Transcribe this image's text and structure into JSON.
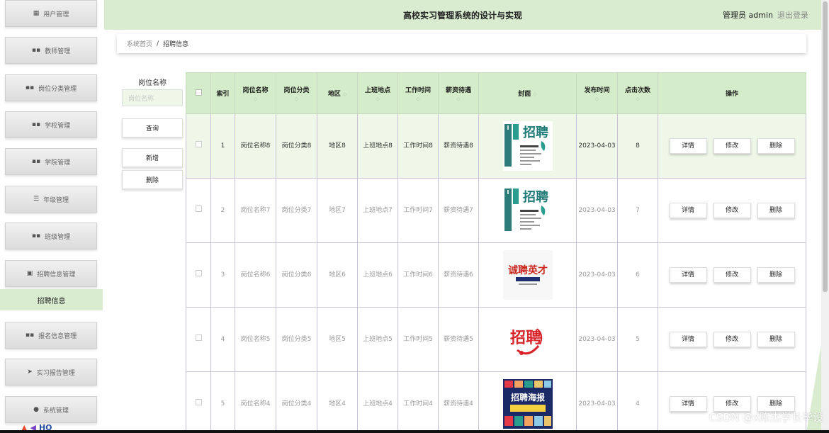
{
  "sidebar": {
    "items": [
      {
        "label": "用户管理",
        "icon": "user-group-icon",
        "glyph": "▦"
      },
      {
        "label": "教师管理",
        "icon": "grid-icon",
        "glyph": "▪▪"
      },
      {
        "label": "岗位分类管理",
        "icon": "grid-icon",
        "glyph": "▪▪"
      },
      {
        "label": "学校管理",
        "icon": "grid-icon",
        "glyph": "▪▪"
      },
      {
        "label": "学院管理",
        "icon": "grid-icon",
        "glyph": "▪▪"
      },
      {
        "label": "年级管理",
        "icon": "list-icon",
        "glyph": "☰"
      },
      {
        "label": "班级管理",
        "icon": "grid-icon",
        "glyph": "▪▪"
      },
      {
        "label": "招聘信息管理",
        "icon": "clipboard-icon",
        "glyph": "▣"
      },
      {
        "label": "报名信息管理",
        "icon": "grid-icon",
        "glyph": "▪▪"
      },
      {
        "label": "实习报告管理",
        "icon": "send-icon",
        "glyph": "➤"
      },
      {
        "label": "系统管理",
        "icon": "pin-icon",
        "glyph": "●"
      }
    ],
    "active_sub": "招聘信息",
    "bottom_logo": "HO"
  },
  "header": {
    "title": "高校实习管理系统的设计与实现",
    "user": "管理员 admin",
    "logout": "退出登录"
  },
  "breadcrumb": {
    "home": "系统首页",
    "sep": "/",
    "current": "招聘信息"
  },
  "search": {
    "label": "岗位名称",
    "placeholder": "岗位名称",
    "query_btn": "查询",
    "add_btn": "新增",
    "delete_btn": "删除"
  },
  "table": {
    "headers": {
      "index": "索引",
      "name": "岗位名称",
      "category": "岗位分类",
      "region": "地区",
      "location": "上班地点",
      "time": "工作时间",
      "salary": "薪资待遇",
      "cover": "封面",
      "date": "发布时间",
      "clicks": "点击次数",
      "ops": "操作"
    },
    "sort_glyph": "◇",
    "actions": {
      "detail": "详情",
      "edit": "修改",
      "delete": "删除"
    },
    "rows": [
      {
        "index": "1",
        "name": "岗位名称8",
        "category": "岗位分类8",
        "region": "地区8",
        "location": "上班地点8",
        "time": "工作时间8",
        "salary": "薪资待遇8",
        "date": "2023-04-03",
        "clicks": "8",
        "cover_text": "招聘"
      },
      {
        "index": "2",
        "name": "岗位名称7",
        "category": "岗位分类7",
        "region": "地区7",
        "location": "上班地点7",
        "time": "工作时间7",
        "salary": "薪资待遇7",
        "date": "2023-04-03",
        "clicks": "7",
        "cover_text": "招聘"
      },
      {
        "index": "3",
        "name": "岗位名称6",
        "category": "岗位分类6",
        "region": "地区6",
        "location": "上班地点6",
        "time": "工作时间6",
        "salary": "薪资待遇6",
        "date": "2023-04-03",
        "clicks": "6",
        "cover_text": "诚聘英才"
      },
      {
        "index": "4",
        "name": "岗位名称5",
        "category": "岗位分类5",
        "region": "地区5",
        "location": "上班地点5",
        "time": "工作时间5",
        "salary": "薪资待遇5",
        "date": "2023-04-03",
        "clicks": "5",
        "cover_text": "招聘"
      },
      {
        "index": "5",
        "name": "岗位名称4",
        "category": "岗位分类4",
        "region": "地区4",
        "location": "上班地点4",
        "time": "工作时间4",
        "salary": "薪资待遇4",
        "date": "2023-04-03",
        "clicks": "4",
        "cover_text": "招聘海报"
      }
    ]
  },
  "watermark": "CSDN @x陈杰学长毕设",
  "colors": {
    "accent": "#d9ecd0",
    "header_row": "#d4ecc9",
    "first_row": "#eef7e8"
  }
}
